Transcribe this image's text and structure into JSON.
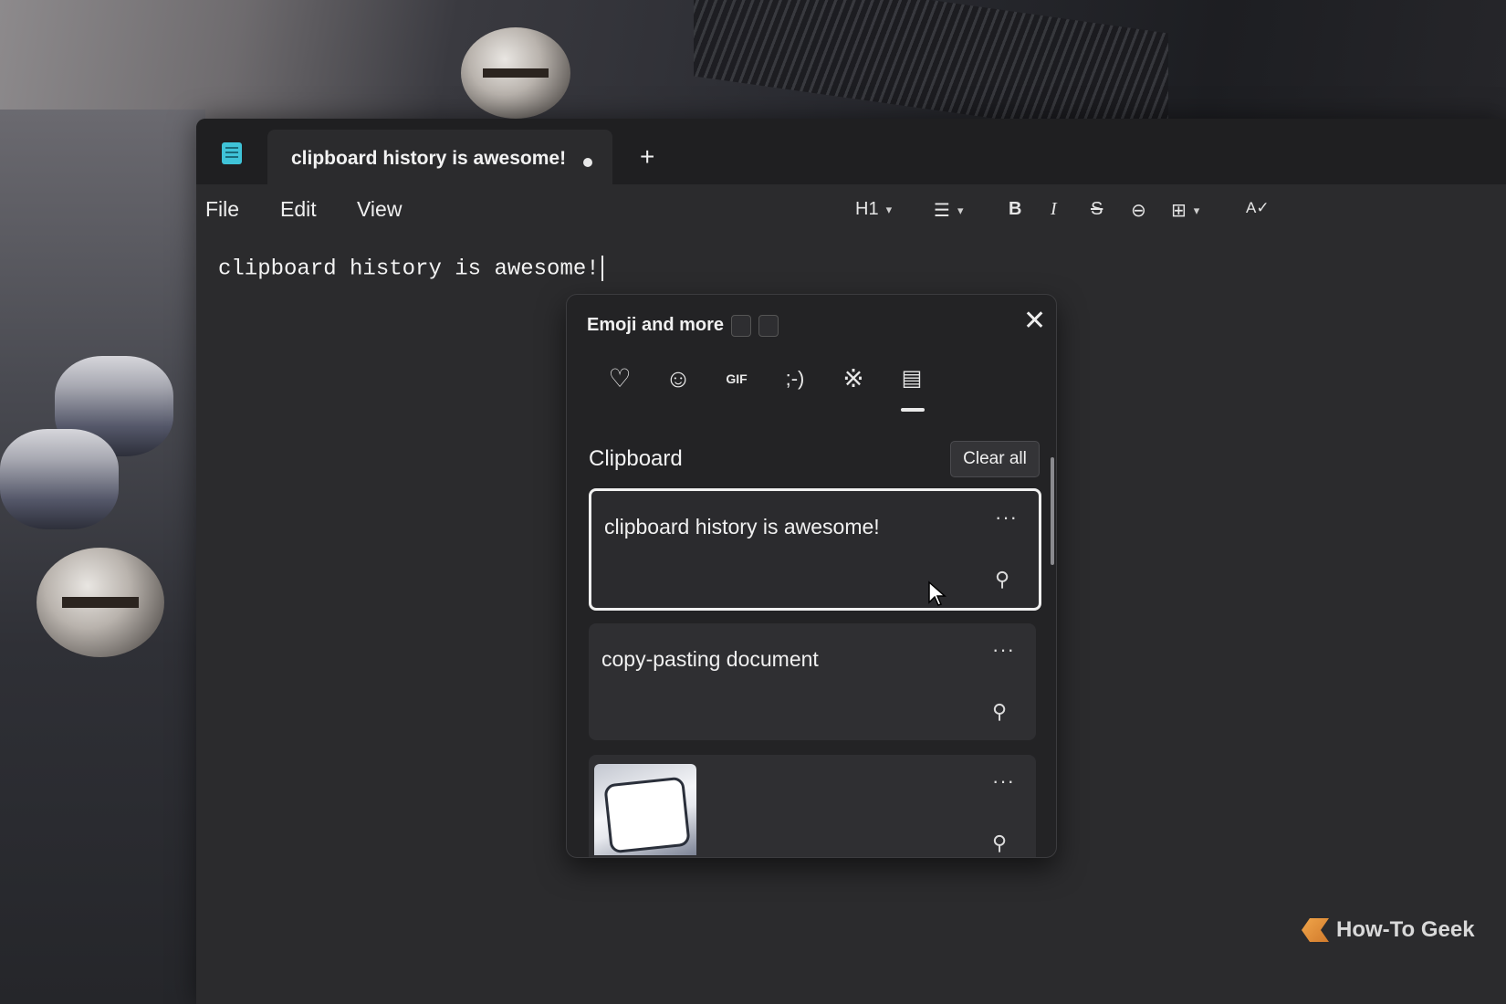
{
  "window": {
    "tab_title": "clipboard history is awesome!",
    "new_tab_glyph": "+",
    "app_icon": "notepad-icon"
  },
  "menu": {
    "file": "File",
    "edit": "Edit",
    "view": "View"
  },
  "toolbar": {
    "heading_label": "H1",
    "list_icon": "list-icon",
    "bold_icon": "bold-icon",
    "italic_icon": "italic-icon",
    "strikethrough_icon": "strikethrough-icon",
    "link_icon": "link-icon",
    "table_icon": "table-icon",
    "spellcheck_icon": "spellcheck-icon"
  },
  "editor": {
    "content": "clipboard history is awesome!"
  },
  "emoji_panel": {
    "title": "Emoji and more",
    "close_glyph": "✕",
    "categories": [
      {
        "name": "favorites-icon",
        "glyph": "♡"
      },
      {
        "name": "emoji-icon",
        "glyph": "☺"
      },
      {
        "name": "gif-icon",
        "glyph": "GIF"
      },
      {
        "name": "kaomoji",
        "glyph": ";-)"
      },
      {
        "name": "symbols-icon",
        "glyph": "※"
      },
      {
        "name": "clipboard-icon",
        "glyph": "📋"
      }
    ],
    "section_title": "Clipboard",
    "clear_all": "Clear all",
    "items": [
      {
        "text": "clipboard history is awesome!",
        "selected": true
      },
      {
        "text": "copy-pasting document",
        "selected": false
      },
      {
        "text": "",
        "type": "image"
      }
    ],
    "more_glyph": "···",
    "pin_glyph": "📌"
  },
  "watermark": {
    "text": "How-To Geek"
  }
}
